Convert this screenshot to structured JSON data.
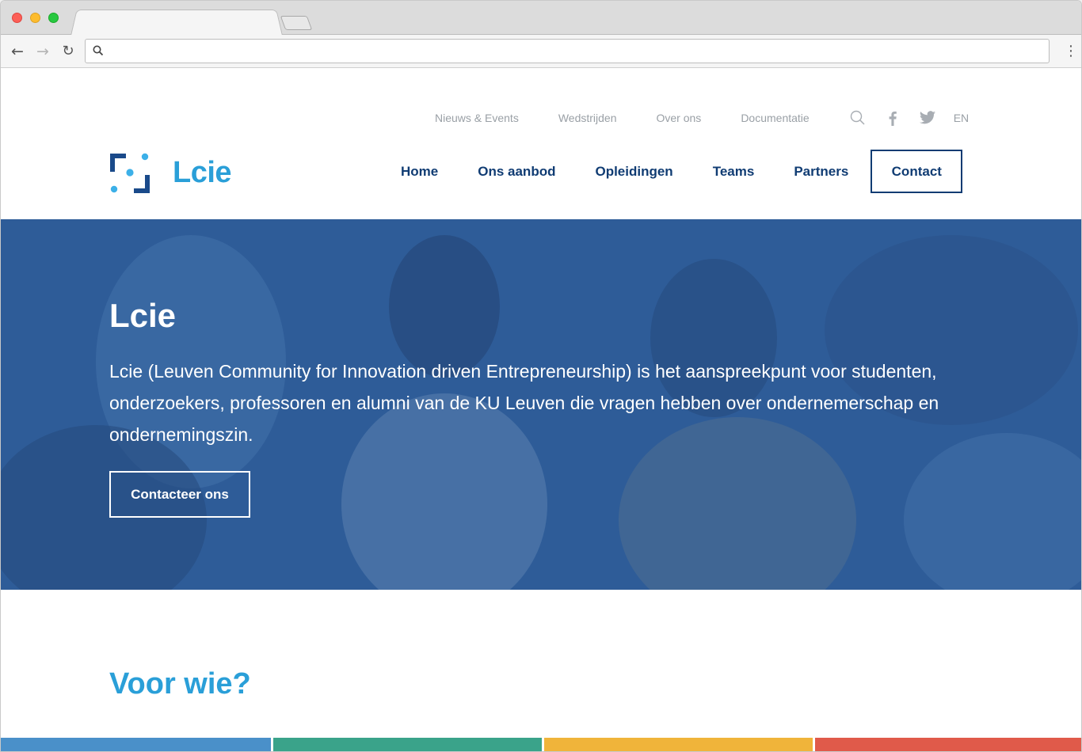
{
  "browser": {
    "url": ""
  },
  "topnav": {
    "items": [
      "Nieuws & Events",
      "Wedstrijden",
      "Over ons",
      "Documentatie"
    ],
    "language": "EN"
  },
  "logo": {
    "text": "Lcie"
  },
  "mainnav": {
    "items": [
      "Home",
      "Ons aanbod",
      "Opleidingen",
      "Teams",
      "Partners"
    ],
    "contact": "Contact"
  },
  "hero": {
    "title": "Lcie",
    "text": "Lcie (Leuven Community for Innovation driven Entrepreneurship) is het aanspreekpunt voor studenten, onderzoekers, professoren en alumni van de KU Leuven die vragen hebben over ondernemerschap en ondernemingszin.",
    "button": "Contacteer ons"
  },
  "section": {
    "title": "Voor wie?"
  },
  "colors": {
    "brand_blue": "#2a9fd8",
    "navy": "#103c73",
    "hero_overlay": "#2e5b97",
    "tile_colors": [
      "#4a90c9",
      "#3aa38a",
      "#f0b43a",
      "#e05a4a"
    ]
  }
}
